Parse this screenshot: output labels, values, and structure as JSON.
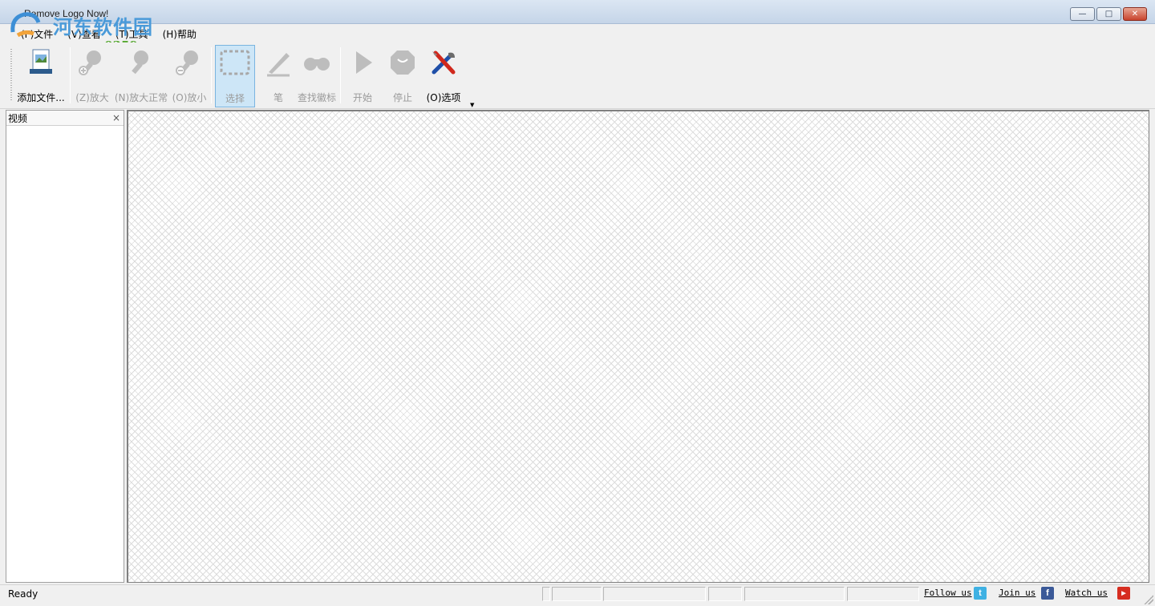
{
  "window": {
    "title": "Remove Logo Now!"
  },
  "watermark": {
    "name": "河东软件园",
    "url": "www.pc0359.cn"
  },
  "menu": [
    {
      "label": "(F)文件"
    },
    {
      "label": "(V)查看"
    },
    {
      "label": "(T)工具"
    },
    {
      "label": "(H)帮助"
    }
  ],
  "toolbar": {
    "add_file": "添加文件...",
    "zoom_in": "(Z)放大",
    "zoom_normal": "(N)放大正常",
    "zoom_out": "(O)放小",
    "select": "选择",
    "pen": "笔",
    "find_logo": "查找徽标",
    "start": "开始",
    "stop": "停止",
    "options": "(O)选项"
  },
  "left_panel": {
    "title": "视频",
    "close": "×"
  },
  "status": {
    "text": "Ready",
    "follow_us": "Follow us",
    "join_us": "Join us",
    "watch_us": "Watch us"
  },
  "colors": {
    "twitter": "#3fb1e3",
    "facebook": "#3b5998",
    "youtube": "#d62d20",
    "selection": "#cde6f7"
  }
}
